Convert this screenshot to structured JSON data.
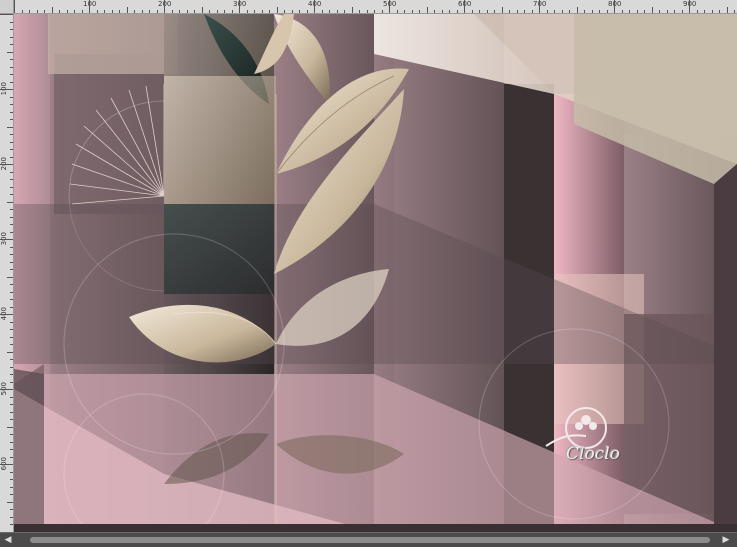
{
  "ruler": {
    "top_labels": [
      "100",
      "200",
      "300",
      "400",
      "500",
      "600",
      "700",
      "800",
      "900"
    ],
    "left_labels": [
      "100",
      "200",
      "300",
      "400",
      "500",
      "600"
    ]
  },
  "artwork": {
    "signature_text": "Cloclo",
    "colors": {
      "dusty_pink": "#d9a9b6",
      "mauve": "#8e767b",
      "taupe": "#b5a48c",
      "dark_teal": "#233a38",
      "cream": "#efe3d2",
      "charcoal": "#262423"
    }
  },
  "scrollbar": {
    "left_arrow": "◀",
    "right_arrow": "▶"
  }
}
